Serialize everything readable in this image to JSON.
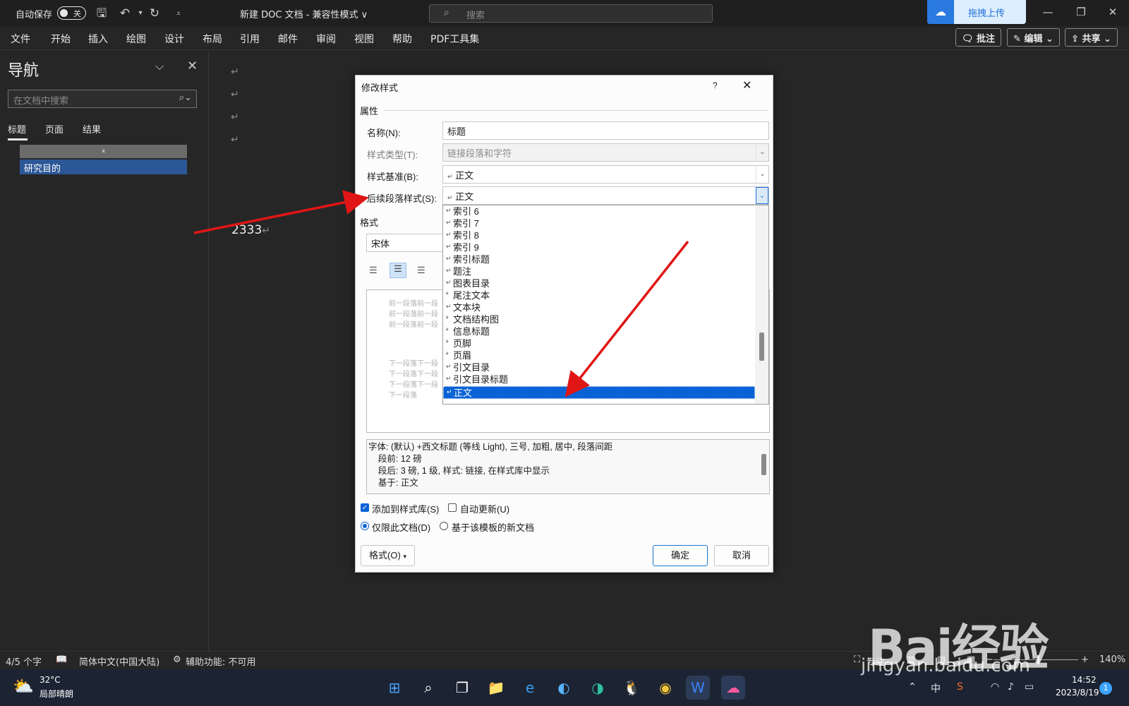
{
  "titlebar": {
    "autosave_label": "自动保存",
    "autosave_state": "关",
    "doc_title": "新建 DOC 文档 - 兼容性模式 ∨",
    "search_placeholder": "搜索",
    "baidu_upload": "拖拽上传"
  },
  "menu": [
    "文件",
    "开始",
    "插入",
    "绘图",
    "设计",
    "布局",
    "引用",
    "邮件",
    "审阅",
    "视图",
    "帮助",
    "PDF工具集"
  ],
  "ribbon_right": {
    "comment": "批注",
    "edit": "编辑",
    "share": "共享"
  },
  "nav": {
    "title": "导航",
    "search_placeholder": "在文档中搜索",
    "tabs": [
      "标题",
      "页面",
      "结果"
    ],
    "collapse_glyph": "⌅",
    "heading_item": "研究目的"
  },
  "document": {
    "text": "2333"
  },
  "dialog": {
    "title": "修改样式",
    "help": "?",
    "section_properties": "属性",
    "name_label": "名称(N):",
    "name_value": "标题",
    "type_label": "样式类型(T):",
    "type_value": "链接段落和字符",
    "based_label": "样式基准(B):",
    "based_value": "正文",
    "next_label": "后续段落样式(S):",
    "next_value": "正文",
    "section_format": "格式",
    "font_value": "宋体",
    "list_items": [
      {
        "mark": "↵",
        "label": "索引 6"
      },
      {
        "mark": "↵",
        "label": "索引 7"
      },
      {
        "mark": "↵",
        "label": "索引 8"
      },
      {
        "mark": "↵",
        "label": "索引 9"
      },
      {
        "mark": "↵",
        "label": "索引标题"
      },
      {
        "mark": "↵",
        "label": "题注"
      },
      {
        "mark": "↵",
        "label": "图表目录"
      },
      {
        "mark": "ª",
        "label": "尾注文本"
      },
      {
        "mark": "↵",
        "label": "文本块"
      },
      {
        "mark": "ª",
        "label": "文档结构图"
      },
      {
        "mark": "ª",
        "label": "信息标题"
      },
      {
        "mark": "ª",
        "label": "页脚"
      },
      {
        "mark": "ª",
        "label": "页眉"
      },
      {
        "mark": "↵",
        "label": "引文目录"
      },
      {
        "mark": "↵",
        "label": "引文目录标题"
      },
      {
        "mark": "↵",
        "label": "正文"
      }
    ],
    "selected_index": 15,
    "preview_prev": [
      "前一段落前一段",
      "前一段落前一段",
      "前一段落前一段"
    ],
    "preview_next": [
      "下一段落下一段",
      "下一段落下一段",
      "下一段落下一段",
      "下一段落"
    ],
    "description": [
      "字体: (默认) +西文标题 (等线 Light), 三号, 加粗, 居中, 段落间距",
      "    段前: 12 磅",
      "    段后: 3 磅, 1 级, 样式: 链接, 在样式库中显示",
      "    基于: 正文"
    ],
    "add_to_gallery": "添加到样式库(S)",
    "auto_update": "自动更新(U)",
    "only_this_doc": "仅限此文档(D)",
    "new_docs": "基于该模板的新文档",
    "format_button": "格式(O)",
    "ok": "确定",
    "cancel": "取消"
  },
  "statusbar": {
    "word_count": "4/5 个字",
    "language": "简体中文(中国大陆)",
    "accessibility": "辅助功能: 不可用",
    "focus": "专注",
    "zoom": "140%"
  },
  "taskbar": {
    "temp": "32°C",
    "weather": "局部晴朗",
    "ime": "中",
    "time": "14:52",
    "date": "2023/8/19",
    "notifications": "1"
  },
  "watermark": {
    "brand": "Bai经验",
    "url": "jingyan.baidu.com"
  },
  "colors": {
    "accent": "#0a63d6",
    "arrow": "#e01515",
    "nav_selected": "#2b5797"
  }
}
